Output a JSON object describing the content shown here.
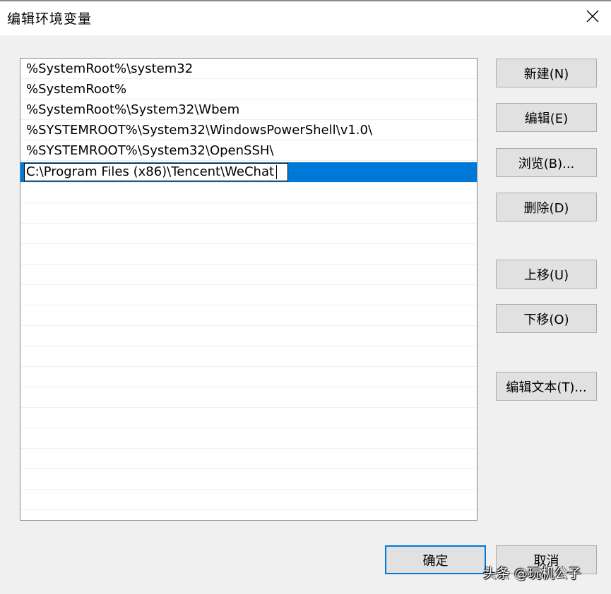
{
  "window": {
    "title": "编辑环境变量",
    "close_icon": "close-icon"
  },
  "list": {
    "items": [
      "%SystemRoot%\\system32",
      "%SystemRoot%",
      "%SystemRoot%\\System32\\Wbem",
      "%SYSTEMROOT%\\System32\\WindowsPowerShell\\v1.0\\",
      "%SYSTEMROOT%\\System32\\OpenSSH\\"
    ],
    "editing_value": "C:\\Program Files (x86)\\Tencent\\WeChat",
    "selection_color": "#0078d7"
  },
  "buttons": {
    "new": "新建(N)",
    "edit": "编辑(E)",
    "browse": "浏览(B)...",
    "delete": "删除(D)",
    "move_up": "上移(U)",
    "move_down": "下移(O)",
    "edit_text": "编辑文本(T)...",
    "ok": "确定",
    "cancel": "取消"
  },
  "watermark": "头条 @玩机公子"
}
